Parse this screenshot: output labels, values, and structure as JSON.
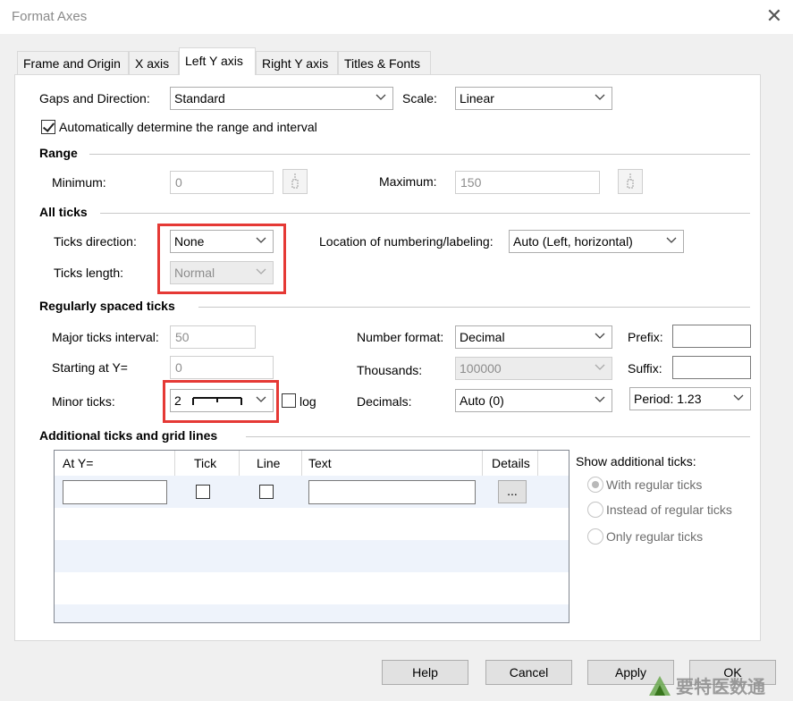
{
  "window": {
    "title": "Format Axes",
    "close": "✕"
  },
  "tabs": [
    {
      "label": "Frame and Origin"
    },
    {
      "label": "X axis"
    },
    {
      "label": "Left Y axis"
    },
    {
      "label": "Right Y axis"
    },
    {
      "label": "Titles & Fonts"
    }
  ],
  "gaps": {
    "label": "Gaps and Direction:",
    "value": "Standard"
  },
  "scale": {
    "label": "Scale:",
    "value": "Linear"
  },
  "auto_range": {
    "label": "Automatically determine the range and interval",
    "checked": true
  },
  "range": {
    "heading": "Range",
    "min_label": "Minimum:",
    "min_value": "0",
    "max_label": "Maximum:",
    "max_value": "150"
  },
  "all_ticks": {
    "heading": "All ticks",
    "direction_label": "Ticks direction:",
    "direction_value": "None",
    "length_label": "Ticks length:",
    "length_value": "Normal",
    "location_label": "Location of numbering/labeling:",
    "location_value": "Auto (Left, horizontal)"
  },
  "regular": {
    "heading": "Regularly spaced ticks",
    "major_label": "Major ticks interval:",
    "major_value": "50",
    "start_label": "Starting at Y=",
    "start_value": "0",
    "minor_label": "Minor ticks:",
    "minor_value": "2",
    "log_label": "log",
    "number_format_label": "Number format:",
    "number_format_value": "Decimal",
    "thousands_label": "Thousands:",
    "thousands_value": "100000",
    "decimals_label": "Decimals:",
    "decimals_value": "Auto (0)",
    "prefix_label": "Prefix:",
    "prefix_value": "",
    "suffix_label": "Suffix:",
    "suffix_value": "",
    "period_value": "Period: 1.23"
  },
  "additional": {
    "heading": "Additional ticks and grid lines",
    "columns": [
      "At Y=",
      "Tick",
      "Line",
      "Text",
      "Details"
    ],
    "details_button": "...",
    "show_label": "Show additional ticks:",
    "options": [
      "With regular ticks",
      "Instead of regular ticks",
      "Only regular ticks"
    ]
  },
  "buttons": {
    "help": "Help",
    "cancel": "Cancel",
    "apply": "Apply",
    "ok": "OK"
  },
  "watermark": "要特医数通"
}
